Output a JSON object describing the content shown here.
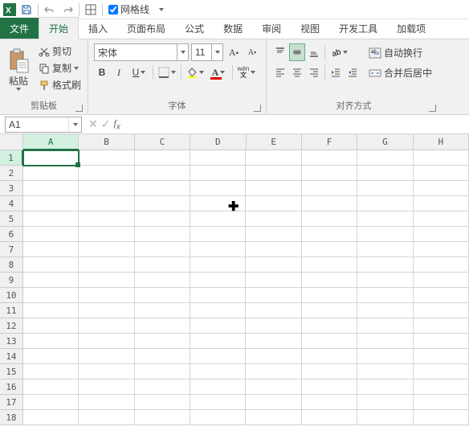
{
  "qat": {
    "gridlines_label": "网格线",
    "gridlines_checked": true
  },
  "tabs": {
    "file": "文件",
    "home": "开始",
    "insert": "插入",
    "layout": "页面布局",
    "formula": "公式",
    "data": "数据",
    "review": "审阅",
    "view": "视图",
    "dev": "开发工具",
    "addin": "加载项"
  },
  "ribbon": {
    "clipboard": {
      "paste": "粘贴",
      "cut": "剪切",
      "copy": "复制",
      "painter": "格式刷",
      "label": "剪贴板"
    },
    "font": {
      "name": "宋体",
      "size": "11",
      "label": "字体",
      "wen": "wén"
    },
    "align": {
      "label": "对齐方式"
    },
    "wrap": {
      "wrap": "自动换行",
      "merge": "合并后居中"
    }
  },
  "namebox": "A1",
  "columns": [
    "A",
    "B",
    "C",
    "D",
    "E",
    "F",
    "G",
    "H"
  ],
  "rows": [
    "1",
    "2",
    "3",
    "4",
    "5",
    "6",
    "7",
    "8",
    "9",
    "10",
    "11",
    "12",
    "13",
    "14",
    "15",
    "16",
    "17",
    "18"
  ],
  "selected": {
    "col": 0,
    "row": 0
  }
}
